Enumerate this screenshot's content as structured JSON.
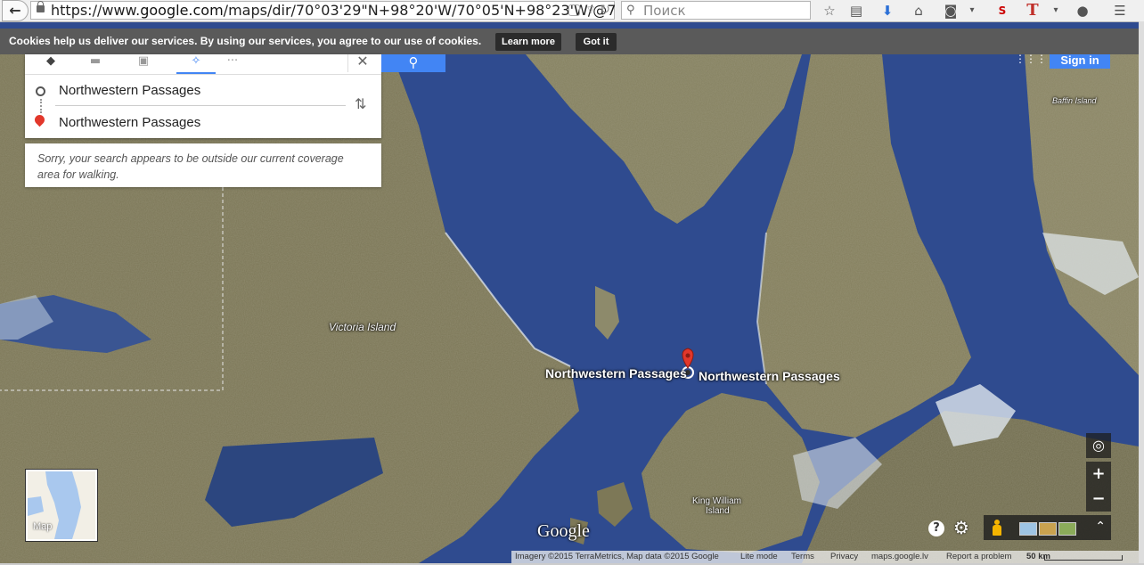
{
  "browser": {
    "url_prefix": "https://www.",
    "url_domain": "google.com",
    "url_rest": "/maps/dir/70°03'29\"N+98°20'W/70°05'N+98°23'W/@7",
    "search_placeholder": "Поиск"
  },
  "cookie_bar": {
    "message": "Cookies help us deliver our services. By using our services, you agree to our use of cookies.",
    "learn_more": "Learn more",
    "got_it": "Got it"
  },
  "directions": {
    "origin": "Northwestern Passages",
    "destination": "Northwestern Passages",
    "error": "Sorry, your search appears to be outside our current coverage area for walking."
  },
  "header": {
    "sign_in": "Sign in"
  },
  "map_labels": {
    "baffin_island": "Baffin Island",
    "victoria_island": "Victoria Island",
    "origin_label": "Northwestern Passages",
    "dest_label": "Northwestern Passages",
    "king_william_1": "King William",
    "king_william_2": "Island",
    "google_logo": "Google"
  },
  "minimap": {
    "label": "Map"
  },
  "controls": {
    "zoom_in": "+",
    "zoom_out": "−"
  },
  "footer": {
    "imagery": "Imagery ©2015 TerraMetrics, Map data ©2015 Google",
    "lite_mode": "Lite mode",
    "terms": "Terms",
    "privacy": "Privacy",
    "domain": "maps.google.lv",
    "report": "Report a problem",
    "scale": "50 km"
  },
  "colors": {
    "water": "#2f4b8f",
    "land": "#7d7a5a",
    "accent_blue": "#4285f4",
    "pin_red": "#e2372b"
  }
}
